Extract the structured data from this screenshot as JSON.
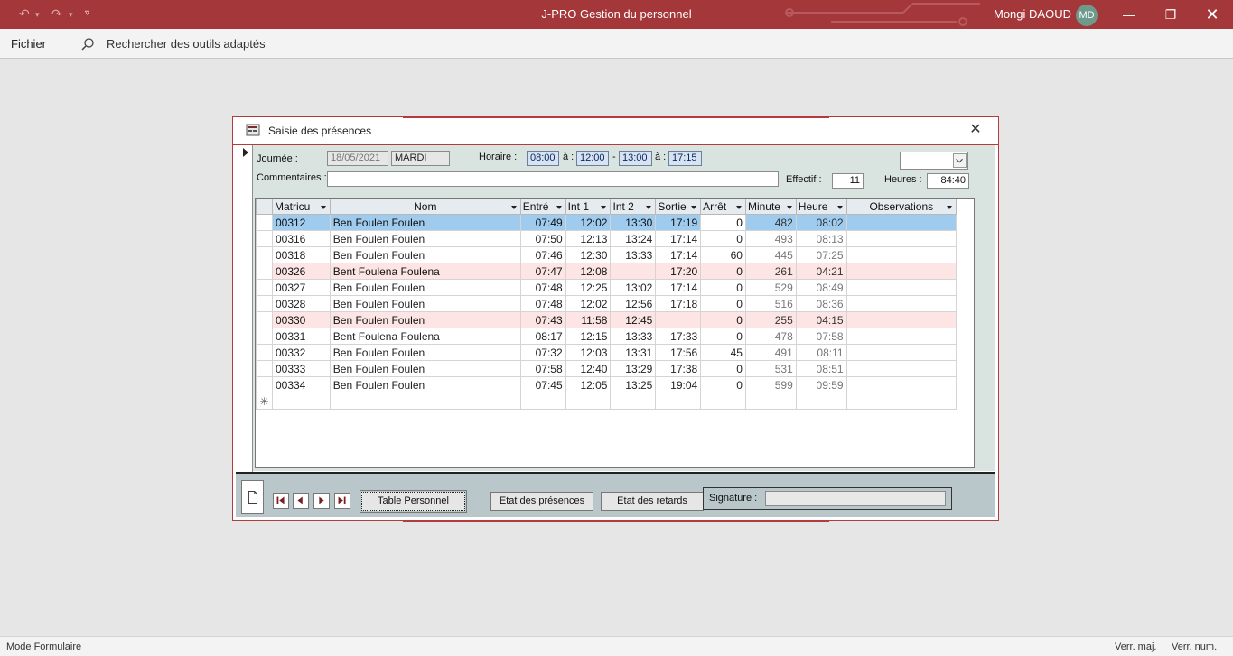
{
  "app": {
    "title": "J-PRO Gestion du personnel",
    "user_name": "Mongi DAOUD",
    "user_initials": "MD",
    "accent": "#a4373a"
  },
  "menu": {
    "file": "Fichier",
    "search_placeholder": "Rechercher des outils adaptés"
  },
  "status": {
    "mode": "Mode Formulaire",
    "caps": "Verr. maj.",
    "num": "Verr. num."
  },
  "form": {
    "title": "Saisie des présences",
    "header": {
      "journee_label": "Journée :",
      "date": "18/05/2021",
      "day": "MARDI",
      "horaire_label": "Horaire :",
      "h1": "08:00",
      "a1": "à :",
      "h2": "12:00",
      "dash": "-",
      "h3": "13:00",
      "a2": "à :",
      "h4": "17:15",
      "commentaires_label": "Commentaires :",
      "commentaires_value": "",
      "effectif_label": "Effectif :",
      "effectif": "11",
      "heures_label": "Heures :",
      "heures": "84:40",
      "combo_value": ""
    },
    "columns": [
      "Matricu",
      "Nom",
      "Entré",
      "Int 1",
      "Int 2",
      "Sortie",
      "Arrêt",
      "Minute",
      "Heure",
      "Observations"
    ],
    "rows": [
      {
        "mat": "00312",
        "nom": "Ben Foulen Foulen",
        "e": "07:49",
        "i1": "12:02",
        "i2": "13:30",
        "s": "17:19",
        "arr": "0",
        "min": "482",
        "h": "08:02",
        "obs": "",
        "state": "selected"
      },
      {
        "mat": "00316",
        "nom": "Ben Foulen Foulen",
        "e": "07:50",
        "i1": "12:13",
        "i2": "13:24",
        "s": "17:14",
        "arr": "0",
        "min": "493",
        "h": "08:13",
        "obs": "",
        "state": ""
      },
      {
        "mat": "00318",
        "nom": "Ben Foulen Foulen",
        "e": "07:46",
        "i1": "12:30",
        "i2": "13:33",
        "s": "17:14",
        "arr": "60",
        "min": "445",
        "h": "07:25",
        "obs": "",
        "state": ""
      },
      {
        "mat": "00326",
        "nom": "Bent Foulena Foulena",
        "e": "07:47",
        "i1": "12:08",
        "i2": "",
        "s": "17:20",
        "arr": "0",
        "min": "261",
        "h": "04:21",
        "obs": "",
        "state": "pink"
      },
      {
        "mat": "00327",
        "nom": "Ben Foulen Foulen",
        "e": "07:48",
        "i1": "12:25",
        "i2": "13:02",
        "s": "17:14",
        "arr": "0",
        "min": "529",
        "h": "08:49",
        "obs": "",
        "state": ""
      },
      {
        "mat": "00328",
        "nom": "Ben Foulen Foulen",
        "e": "07:48",
        "i1": "12:02",
        "i2": "12:56",
        "s": "17:18",
        "arr": "0",
        "min": "516",
        "h": "08:36",
        "obs": "",
        "state": ""
      },
      {
        "mat": "00330",
        "nom": "Ben Foulen Foulen",
        "e": "07:43",
        "i1": "11:58",
        "i2": "12:45",
        "s": "",
        "arr": "0",
        "min": "255",
        "h": "04:15",
        "obs": "",
        "state": "pink"
      },
      {
        "mat": "00331",
        "nom": "Bent Foulena Foulena",
        "e": "08:17",
        "i1": "12:15",
        "i2": "13:33",
        "s": "17:33",
        "arr": "0",
        "min": "478",
        "h": "07:58",
        "obs": "",
        "state": ""
      },
      {
        "mat": "00332",
        "nom": "Ben Foulen Foulen",
        "e": "07:32",
        "i1": "12:03",
        "i2": "13:31",
        "s": "17:56",
        "arr": "45",
        "min": "491",
        "h": "08:11",
        "obs": "",
        "state": ""
      },
      {
        "mat": "00333",
        "nom": "Ben Foulen Foulen",
        "e": "07:58",
        "i1": "12:40",
        "i2": "13:29",
        "s": "17:38",
        "arr": "0",
        "min": "531",
        "h": "08:51",
        "obs": "",
        "state": ""
      },
      {
        "mat": "00334",
        "nom": "Ben Foulen Foulen",
        "e": "07:45",
        "i1": "12:05",
        "i2": "13:25",
        "s": "19:04",
        "arr": "0",
        "min": "599",
        "h": "09:59",
        "obs": "",
        "state": ""
      }
    ],
    "new_row_marker": "✳",
    "footer": {
      "btn_table": "Table Personnel",
      "btn_presences": "Etat des présences",
      "btn_retards": "Etat des retards",
      "signature_label": "Signature :",
      "signature_value": ""
    }
  }
}
